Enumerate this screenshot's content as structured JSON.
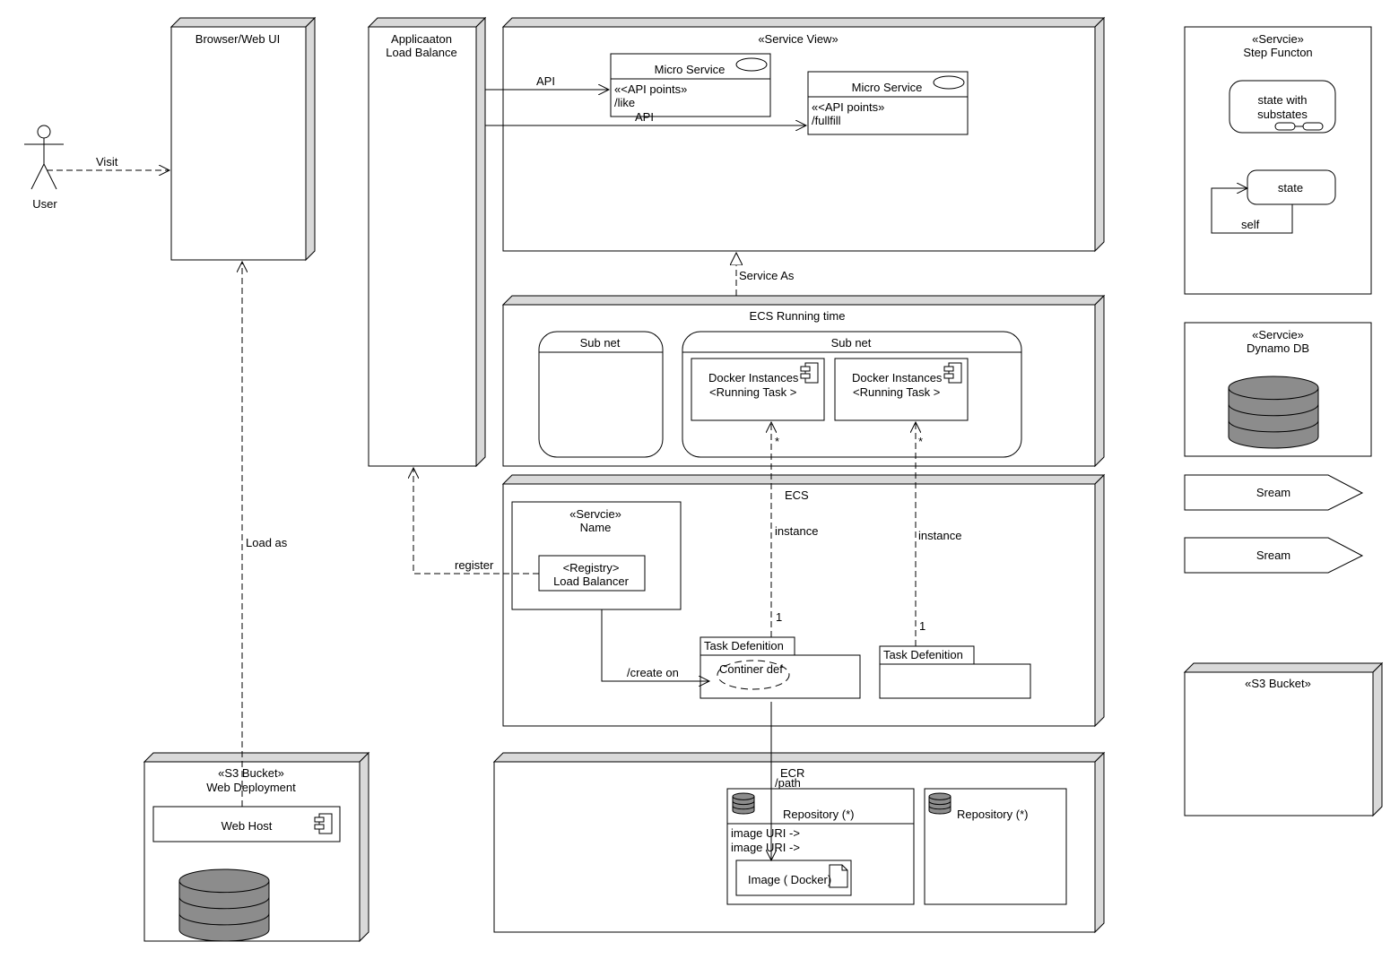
{
  "diagram": {
    "colors": {
      "line": "#000000",
      "node_side": "#d9d9d9",
      "db_fill": "#8c8c8c",
      "background": "#ffffff"
    },
    "actor": {
      "label": "User"
    },
    "nodes": {
      "browser": {
        "title": "Browser/Web UI"
      },
      "alb": {
        "title_line1": "Applicaaton",
        "title_line2": "Load Balance"
      },
      "service_view": {
        "title": "«Service View»"
      },
      "ecs_running": {
        "title": "ECS Running time"
      },
      "ecs": {
        "title": "ECS"
      },
      "ecr": {
        "title": "ECR"
      },
      "s3_web": {
        "stereotype": "«S3 Bucket»",
        "title": "Web Deployment"
      },
      "s3_right": {
        "stereotype": "«S3 Bucket»"
      }
    },
    "micro_services": [
      {
        "title": "Micro Service",
        "stereotype": "«<API points»",
        "endpoint": "/like"
      },
      {
        "title": "Micro Service",
        "stereotype": "«<API points»",
        "endpoint": "/fullfill"
      }
    ],
    "subnets": [
      {
        "title": "Sub net"
      },
      {
        "title": "Sub net"
      }
    ],
    "docker_instances": [
      {
        "line1": "Docker Instances",
        "line2": "<Running Task >"
      },
      {
        "line1": "Docker Instances",
        "line2": "<Running Task >"
      }
    ],
    "ecs_service": {
      "stereotype": "«Servcie»",
      "name": "Name",
      "registry_line1": "<Registry>",
      "registry_line2": "Load Balancer"
    },
    "task_definitions": [
      {
        "tab": "Task Defenition",
        "content": "Continer def"
      },
      {
        "tab": "Task Defenition",
        "content": ""
      }
    ],
    "repositories": [
      {
        "title": "Repository (*)",
        "uri_line1": "image URI ->",
        "uri_line2": "image URI ->",
        "image": "Image ( Docker)"
      },
      {
        "title": "Repository (*)"
      }
    ],
    "web_host": {
      "label": "Web Host"
    },
    "step_function": {
      "stereotype": "«Servcie»",
      "title": "Step Functon",
      "composite_state_line1": "state with",
      "composite_state_line2": "substates",
      "state": "state",
      "self_transition": "self"
    },
    "dynamo": {
      "stereotype": "«Servcie»",
      "title": "Dynamo DB"
    },
    "streams": [
      {
        "label": "Sream"
      },
      {
        "label": "Sream"
      }
    ],
    "connectors": {
      "visit": "Visit",
      "api_1": "API",
      "api_2": "API",
      "service_as": "Service As",
      "load_as": "Load as",
      "register": "register",
      "create_on": "/create on",
      "instance_1": "instance",
      "instance_2": "instance",
      "mult_many_1": "*",
      "mult_many_2": "*",
      "mult_one_1": "1",
      "mult_one_2": "1",
      "path": "/path"
    }
  }
}
